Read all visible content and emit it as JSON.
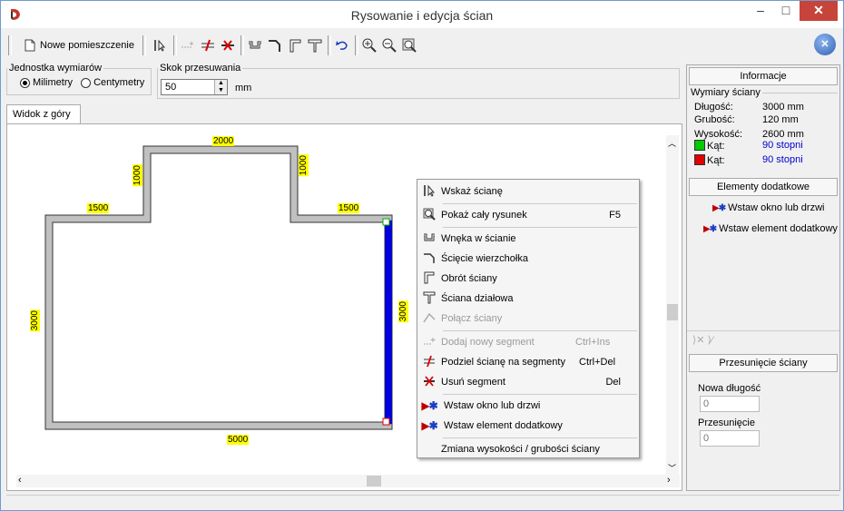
{
  "window": {
    "title": "Rysowanie i edycja ścian",
    "minimize": "–",
    "maximize": "□",
    "close": "✕"
  },
  "toolbar": {
    "new_room_label": "Nowe pomieszczenie"
  },
  "units": {
    "legend": "Jednostka wymiarów",
    "mm_label": "Milimetry",
    "cm_label": "Centymetry",
    "selected": "Milimetry"
  },
  "step": {
    "legend": "Skok przesuwania",
    "value": "50",
    "unit": "mm"
  },
  "tab": {
    "label": "Widok z góry"
  },
  "drawing": {
    "dims": {
      "top": "2000",
      "left_up": "1000",
      "right_up": "1000",
      "left_top": "1500",
      "right_top": "1500",
      "left": "3000",
      "right": "3000",
      "bottom": "5000"
    },
    "wall_color": "#c0c0c0",
    "selected_wall_color": "#0000e0",
    "dim_bg": "#ffff00"
  },
  "context_menu": {
    "items": [
      {
        "icon": "select-wall-icon",
        "label": "Wskaż ścianę",
        "shortcut": "",
        "disabled": false
      },
      {
        "icon": "zoom-all-icon",
        "label": "Pokaż cały rysunek",
        "shortcut": "F5",
        "disabled": false
      },
      {
        "icon": "niche-icon",
        "label": "Wnęka w ścianie",
        "shortcut": "",
        "disabled": false
      },
      {
        "icon": "corner-cut-icon",
        "label": "Ścięcie wierzchołka",
        "shortcut": "",
        "disabled": false
      },
      {
        "icon": "rotate-wall-icon",
        "label": "Obrót ściany",
        "shortcut": "",
        "disabled": false
      },
      {
        "icon": "partition-wall-icon",
        "label": "Ściana działowa",
        "shortcut": "",
        "disabled": false
      },
      {
        "icon": "join-walls-icon",
        "label": "Połącz ściany",
        "shortcut": "",
        "disabled": true
      },
      {
        "icon": "add-segment-icon",
        "label": "Dodaj nowy segment",
        "shortcut": "Ctrl+Ins",
        "disabled": true
      },
      {
        "icon": "split-wall-icon",
        "label": "Podziel ścianę na segmenty",
        "shortcut": "Ctrl+Del",
        "disabled": false
      },
      {
        "icon": "delete-segment-icon",
        "label": "Usuń segment",
        "shortcut": "Del",
        "disabled": false
      },
      {
        "icon": "insert-window-icon",
        "label": "Wstaw okno lub drzwi",
        "shortcut": "",
        "disabled": false
      },
      {
        "icon": "insert-element-icon",
        "label": "Wstaw element dodatkowy",
        "shortcut": "",
        "disabled": false
      },
      {
        "icon": "",
        "label": "Zmiana wysokości / grubości ściany",
        "shortcut": "",
        "disabled": false
      }
    ]
  },
  "info": {
    "header": "Informacje",
    "group": "Wymiary ściany",
    "length_label": "Długość:",
    "length_value": "3000 mm",
    "thickness_label": "Grubość:",
    "thickness_value": "120 mm",
    "height_label": "Wysokość:",
    "height_value": "2600 mm",
    "angle1_label": "Kąt:",
    "angle1_value": "90 stopni",
    "angle1_color": "#00cc00",
    "angle2_label": "Kąt:",
    "angle2_value": "90 stopni",
    "angle2_color": "#e00000"
  },
  "extras": {
    "header": "Elementy dodatkowe",
    "window_door": "Wstaw okno lub drzwi",
    "element": "Wstaw element dodatkowy"
  },
  "shift": {
    "header": "Przesunięcie ściany",
    "new_length_label": "Nowa długość",
    "new_length_value": "0",
    "shift_label": "Przesunięcie",
    "shift_value": "0"
  }
}
